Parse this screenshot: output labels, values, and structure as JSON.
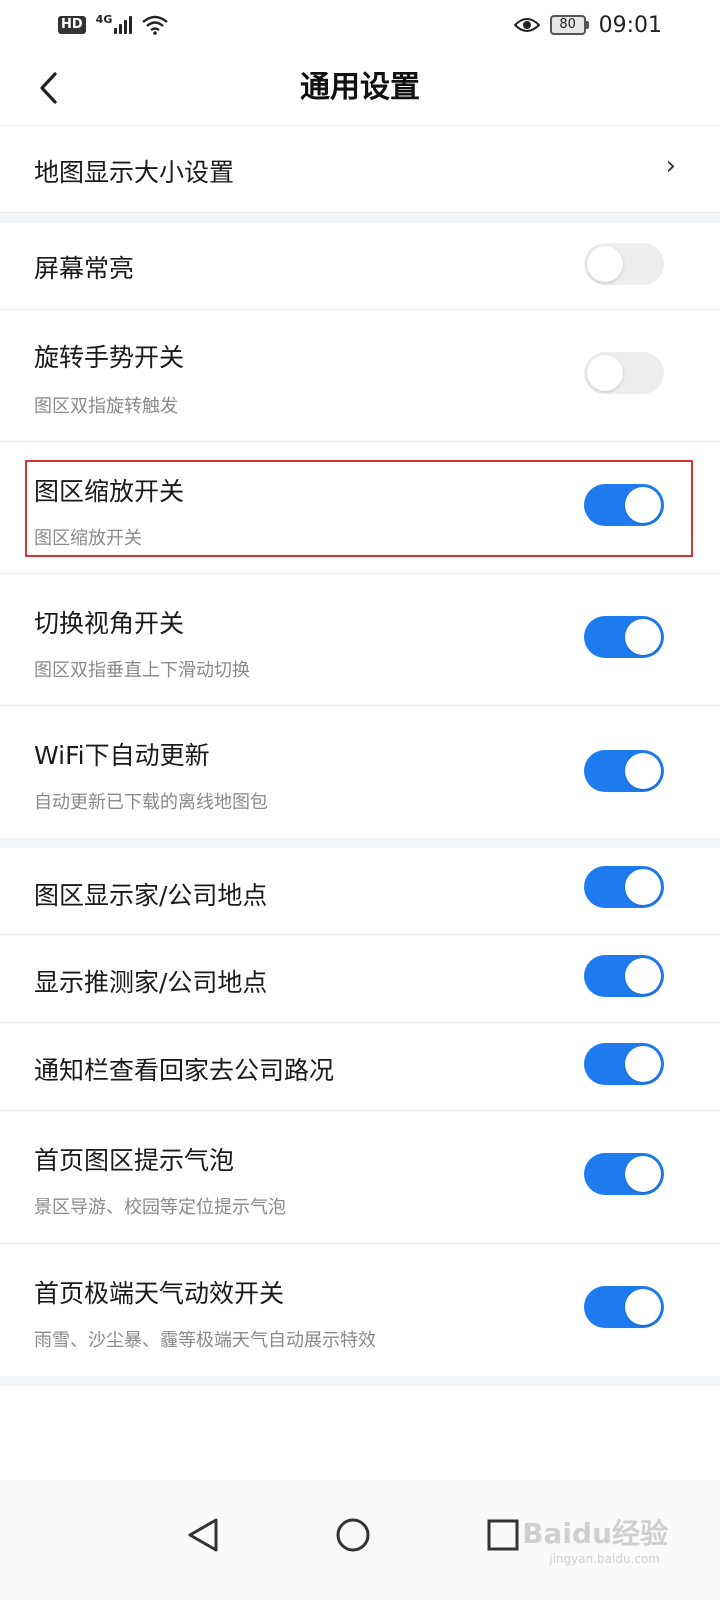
{
  "status_bar": {
    "hd": "HD",
    "network": "4G",
    "battery_level": "80",
    "time": "09:01"
  },
  "header": {
    "title": "通用设置",
    "back_icon": "chevron-left-icon"
  },
  "settings": {
    "map_display_size": {
      "label": "地图显示大小设置",
      "icon": "chevron-right-icon"
    },
    "screen_always_on": {
      "label": "屏幕常亮",
      "enabled": false
    },
    "rotate_gesture": {
      "label": "旋转手势开关",
      "desc": "图区双指旋转触发",
      "enabled": false
    },
    "map_zoom": {
      "label": "图区缩放开关",
      "desc": "图区缩放开关",
      "enabled": true
    },
    "switch_view": {
      "label": "切换视角开关",
      "desc": "图区双指垂直上下滑动切换",
      "enabled": true
    },
    "wifi_auto_update": {
      "label": "WiFi下自动更新",
      "desc": "自动更新已下载的离线地图包",
      "enabled": true
    },
    "show_home_company": {
      "label": "图区显示家/公司地点",
      "enabled": true
    },
    "predict_home_company": {
      "label": "显示推测家/公司地点",
      "enabled": true
    },
    "notification_traffic": {
      "label": "通知栏查看回家去公司路况",
      "enabled": true
    },
    "homepage_bubble": {
      "label": "首页图区提示气泡",
      "desc": "景区导游、校园等定位提示气泡",
      "enabled": true
    },
    "extreme_weather": {
      "label": "首页极端天气动效开关",
      "desc": "雨雪、沙尘暴、霾等极端天气自动展示特效",
      "enabled": true
    }
  },
  "colors": {
    "toggle_on": "#1f7cf0",
    "toggle_off": "#eeeeef",
    "highlight": "#d33a2e"
  },
  "nav_bar": {
    "back": "triangle-back-icon",
    "home": "circle-home-icon",
    "recent": "square-recent-icon"
  },
  "watermark": {
    "text": "Baidu经验",
    "sub": "jingyan.baidu.com"
  }
}
